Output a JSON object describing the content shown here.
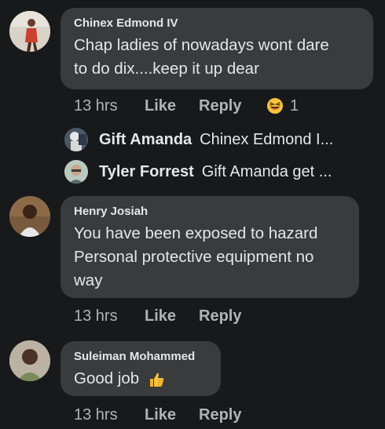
{
  "comments": [
    {
      "name": "Chinex Edmond IV",
      "text_lines": [
        "Chap ladies of nowadays wont dare",
        "to do dix....keep it up dear"
      ],
      "time": "13 hrs",
      "like": "Like",
      "reply": "Reply",
      "reaction_icon": "laughing-emoji-icon",
      "reaction_count": "1"
    },
    {
      "name": "Henry Josiah",
      "text_lines": [
        "You have been exposed to hazard",
        "Personal protective equipment no",
        "way"
      ],
      "time": "13 hrs",
      "like": "Like",
      "reply": "Reply"
    },
    {
      "name": "Suleiman Mohammed",
      "text": "Good job",
      "emoji_icon": "thumbs-up-emoji-icon",
      "time": "13 hrs",
      "like": "Like",
      "reply": "Reply"
    }
  ],
  "replies": [
    {
      "name": "Gift Amanda",
      "preview": "Chinex Edmond I..."
    },
    {
      "name": "Tyler Forrest",
      "preview": "Gift Amanda get ..."
    }
  ],
  "colors": {
    "background": "#18191a",
    "bubble": "#3a3b3c",
    "text": "#e4e6eb",
    "secondary": "#b0b3b8"
  }
}
